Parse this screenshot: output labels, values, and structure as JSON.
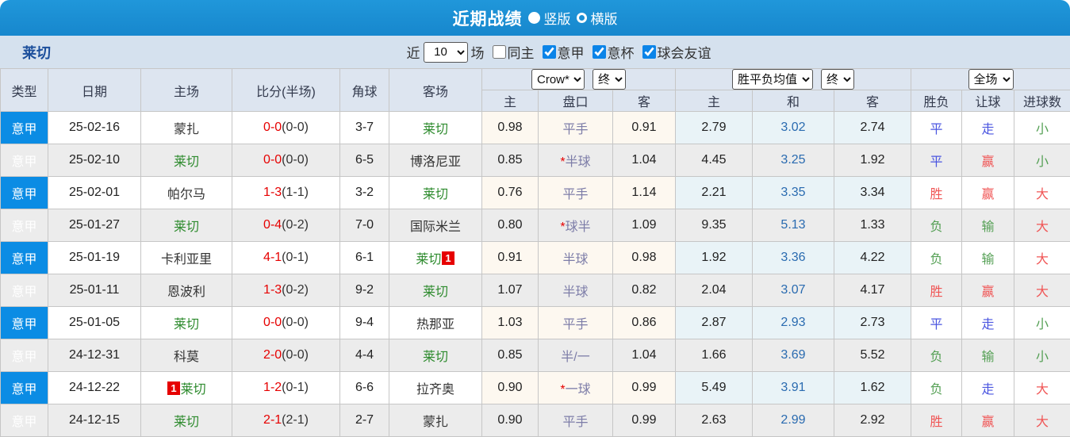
{
  "title_bar": {
    "title": "近期战绩",
    "layout_options": [
      {
        "label": "竖版",
        "selected": true
      },
      {
        "label": "横版",
        "selected": false
      }
    ]
  },
  "filter_bar": {
    "team": "莱切",
    "recent_label": "近",
    "count_value": "10",
    "matches_label": "场",
    "filters": [
      {
        "label": "同主",
        "checked": false
      },
      {
        "label": "意甲",
        "checked": true
      },
      {
        "label": "意杯",
        "checked": true
      },
      {
        "label": "球会友谊",
        "checked": true
      }
    ]
  },
  "table": {
    "headers": {
      "type": "类型",
      "date": "日期",
      "home": "主场",
      "score": "比分(半场)",
      "corners": "角球",
      "away": "客场",
      "asian_sub": [
        "主",
        "盘口",
        "客"
      ],
      "europe_sub": [
        "主",
        "和",
        "客"
      ],
      "result_sub": [
        "胜负",
        "让球",
        "进球数"
      ]
    },
    "selects": {
      "asian_source": "Crow*",
      "asian_time": "终",
      "europe_source": "胜平负均值",
      "europe_time": "终",
      "result_scope": "全场"
    },
    "rows": [
      {
        "league": "意甲",
        "date": "25-02-16",
        "home": {
          "name": "蒙扎",
          "focus": false
        },
        "score_ft": "0-0",
        "score_ht": "(0-0)",
        "corners": "3-7",
        "away": {
          "name": "莱切",
          "focus": true
        },
        "asian": {
          "home": "0.98",
          "star": false,
          "handicap": "平手",
          "away": "0.91"
        },
        "europe": {
          "home": "2.79",
          "draw": "3.02",
          "away": "2.74"
        },
        "result": {
          "outcome": "平",
          "outcome_color": "blue",
          "handicap": "走",
          "handicap_color": "blue",
          "goals": "小",
          "goals_color": "green"
        }
      },
      {
        "league": "意甲",
        "date": "25-02-10",
        "home": {
          "name": "莱切",
          "focus": true
        },
        "score_ft": "0-0",
        "score_ht": "(0-0)",
        "corners": "6-5",
        "away": {
          "name": "博洛尼亚",
          "focus": false
        },
        "asian": {
          "home": "0.85",
          "star": true,
          "handicap": "半球",
          "away": "1.04"
        },
        "europe": {
          "home": "4.45",
          "draw": "3.25",
          "away": "1.92"
        },
        "result": {
          "outcome": "平",
          "outcome_color": "blue",
          "handicap": "赢",
          "handicap_color": "red",
          "goals": "小",
          "goals_color": "green"
        }
      },
      {
        "league": "意甲",
        "date": "25-02-01",
        "home": {
          "name": "帕尔马",
          "focus": false
        },
        "score_ft": "1-3",
        "score_ht": "(1-1)",
        "corners": "3-2",
        "away": {
          "name": "莱切",
          "focus": true
        },
        "asian": {
          "home": "0.76",
          "star": false,
          "handicap": "平手",
          "away": "1.14"
        },
        "europe": {
          "home": "2.21",
          "draw": "3.35",
          "away": "3.34"
        },
        "result": {
          "outcome": "胜",
          "outcome_color": "red",
          "handicap": "赢",
          "handicap_color": "red",
          "goals": "大",
          "goals_color": "red"
        }
      },
      {
        "league": "意甲",
        "date": "25-01-27",
        "home": {
          "name": "莱切",
          "focus": true
        },
        "score_ft": "0-4",
        "score_ht": "(0-2)",
        "corners": "7-0",
        "away": {
          "name": "国际米兰",
          "focus": false
        },
        "asian": {
          "home": "0.80",
          "star": true,
          "handicap": "球半",
          "away": "1.09"
        },
        "europe": {
          "home": "9.35",
          "draw": "5.13",
          "away": "1.33"
        },
        "result": {
          "outcome": "负",
          "outcome_color": "green",
          "handicap": "输",
          "handicap_color": "green",
          "goals": "大",
          "goals_color": "red"
        }
      },
      {
        "league": "意甲",
        "date": "25-01-19",
        "home": {
          "name": "卡利亚里",
          "focus": false
        },
        "score_ft": "4-1",
        "score_ht": "(0-1)",
        "corners": "6-1",
        "away": {
          "name": "莱切",
          "focus": true,
          "badge": "1",
          "badge_pos": "after"
        },
        "asian": {
          "home": "0.91",
          "star": false,
          "handicap": "半球",
          "away": "0.98"
        },
        "europe": {
          "home": "1.92",
          "draw": "3.36",
          "away": "4.22"
        },
        "result": {
          "outcome": "负",
          "outcome_color": "green",
          "handicap": "输",
          "handicap_color": "green",
          "goals": "大",
          "goals_color": "red"
        }
      },
      {
        "league": "意甲",
        "date": "25-01-11",
        "home": {
          "name": "恩波利",
          "focus": false
        },
        "score_ft": "1-3",
        "score_ht": "(0-2)",
        "corners": "9-2",
        "away": {
          "name": "莱切",
          "focus": true
        },
        "asian": {
          "home": "1.07",
          "star": false,
          "handicap": "半球",
          "away": "0.82"
        },
        "europe": {
          "home": "2.04",
          "draw": "3.07",
          "away": "4.17"
        },
        "result": {
          "outcome": "胜",
          "outcome_color": "red",
          "handicap": "赢",
          "handicap_color": "red",
          "goals": "大",
          "goals_color": "red"
        }
      },
      {
        "league": "意甲",
        "date": "25-01-05",
        "home": {
          "name": "莱切",
          "focus": true
        },
        "score_ft": "0-0",
        "score_ht": "(0-0)",
        "corners": "9-4",
        "away": {
          "name": "热那亚",
          "focus": false
        },
        "asian": {
          "home": "1.03",
          "star": false,
          "handicap": "平手",
          "away": "0.86"
        },
        "europe": {
          "home": "2.87",
          "draw": "2.93",
          "away": "2.73"
        },
        "result": {
          "outcome": "平",
          "outcome_color": "blue",
          "handicap": "走",
          "handicap_color": "blue",
          "goals": "小",
          "goals_color": "green"
        }
      },
      {
        "league": "意甲",
        "date": "24-12-31",
        "home": {
          "name": "科莫",
          "focus": false
        },
        "score_ft": "2-0",
        "score_ht": "(0-0)",
        "corners": "4-4",
        "away": {
          "name": "莱切",
          "focus": true
        },
        "asian": {
          "home": "0.85",
          "star": false,
          "handicap": "半/一",
          "away": "1.04"
        },
        "europe": {
          "home": "1.66",
          "draw": "3.69",
          "away": "5.52"
        },
        "result": {
          "outcome": "负",
          "outcome_color": "green",
          "handicap": "输",
          "handicap_color": "green",
          "goals": "小",
          "goals_color": "green"
        }
      },
      {
        "league": "意甲",
        "date": "24-12-22",
        "home": {
          "name": "莱切",
          "focus": true,
          "badge": "1",
          "badge_pos": "before"
        },
        "score_ft": "1-2",
        "score_ht": "(0-1)",
        "corners": "6-6",
        "away": {
          "name": "拉齐奥",
          "focus": false
        },
        "asian": {
          "home": "0.90",
          "star": true,
          "handicap": "一球",
          "away": "0.99"
        },
        "europe": {
          "home": "5.49",
          "draw": "3.91",
          "away": "1.62"
        },
        "result": {
          "outcome": "负",
          "outcome_color": "green",
          "handicap": "走",
          "handicap_color": "blue",
          "goals": "大",
          "goals_color": "red"
        }
      },
      {
        "league": "意甲",
        "date": "24-12-15",
        "home": {
          "name": "莱切",
          "focus": true
        },
        "score_ft": "2-1",
        "score_ht": "(2-1)",
        "corners": "2-7",
        "away": {
          "name": "蒙扎",
          "focus": false
        },
        "asian": {
          "home": "0.90",
          "star": false,
          "handicap": "平手",
          "away": "0.99"
        },
        "europe": {
          "home": "2.63",
          "draw": "2.99",
          "away": "2.92"
        },
        "result": {
          "outcome": "胜",
          "outcome_color": "red",
          "handicap": "赢",
          "handicap_color": "red",
          "goals": "大",
          "goals_color": "red"
        }
      }
    ]
  },
  "colors": {
    "title_bar_blue": "#1a8ed6",
    "league_cell_blue": "#0b8ce4",
    "filter_bar_bg": "#d5e1ee",
    "header_bg": "#dde5f0",
    "asian_col_bg": "#fdf8f0",
    "euro_col_bg": "#e9f3f7",
    "focus_team_green": "#2e8b2e",
    "score_red": "#e60000",
    "draw_odds_blue": "#2a6bb0",
    "handicap_slate": "#7d7da8",
    "result_red": "#f05555",
    "result_blue": "#4a55e0",
    "result_green": "#55a055"
  }
}
